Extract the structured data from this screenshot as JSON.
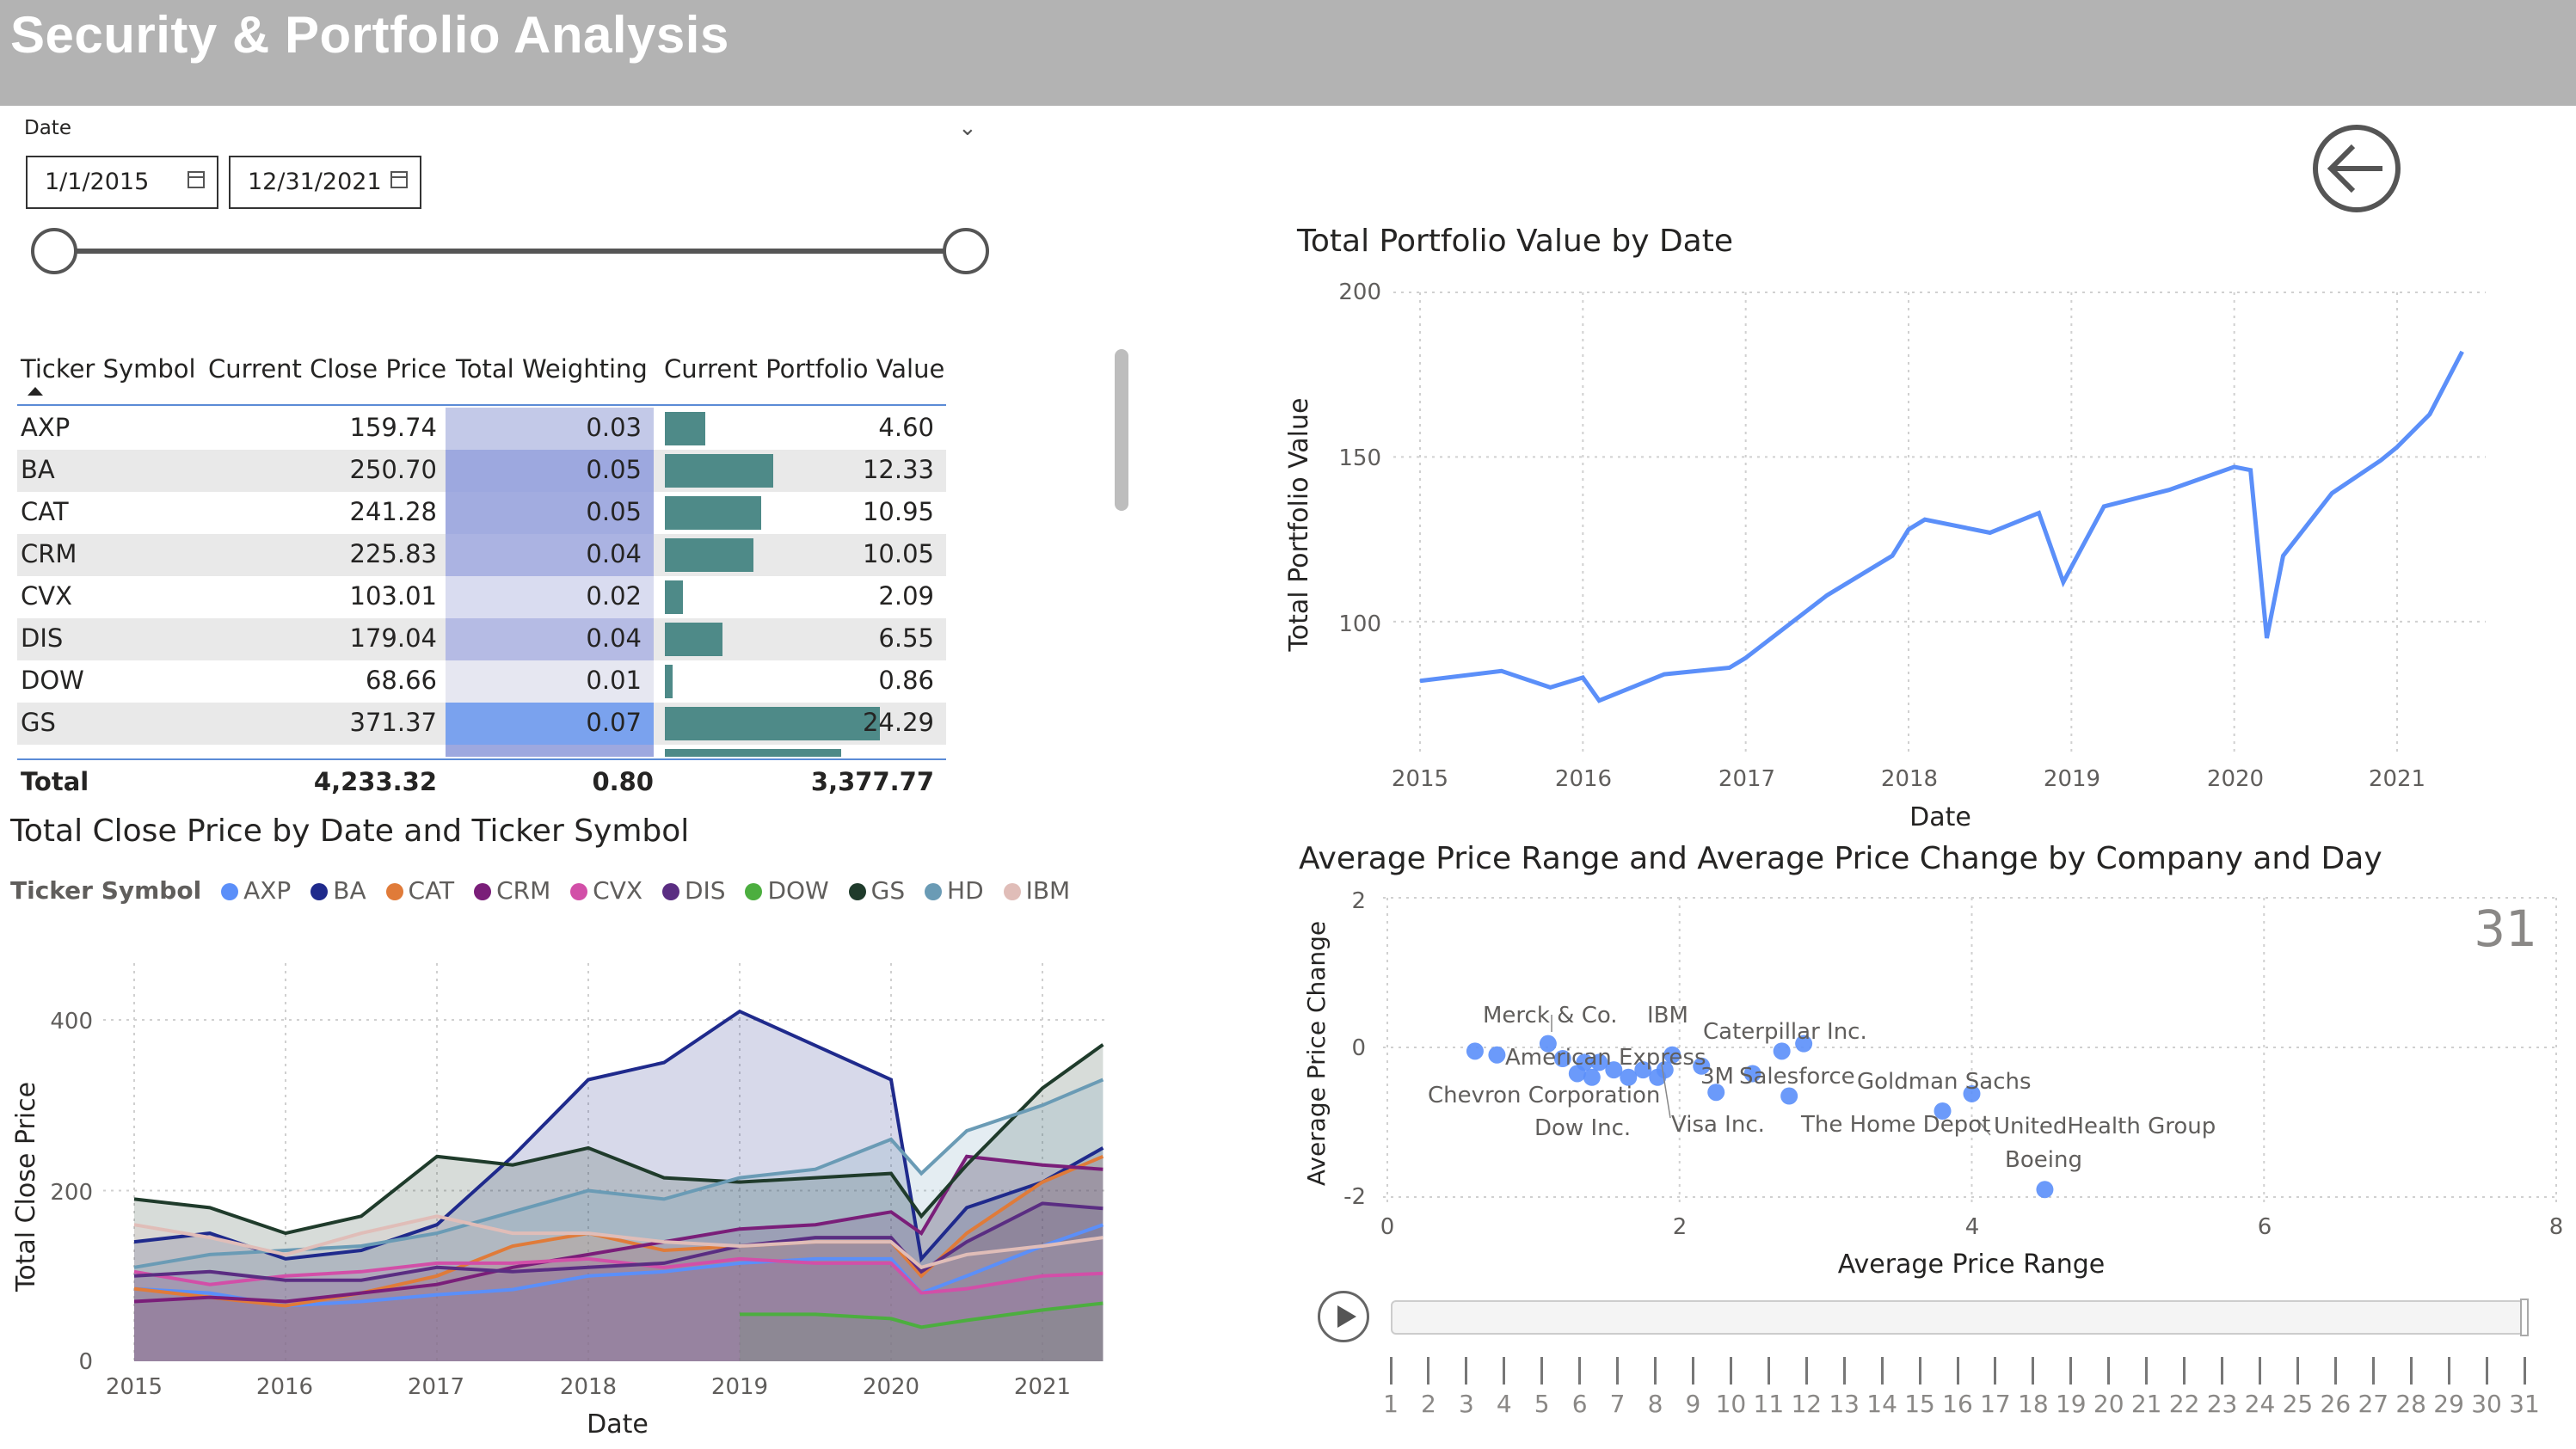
{
  "header": {
    "title": "Security & Portfolio Analysis"
  },
  "date_slicer": {
    "label": "Date",
    "start": "1/1/2015",
    "end": "12/31/2021"
  },
  "table": {
    "columns": [
      "Ticker Symbol",
      "Current Close Price",
      "Total Weighting",
      "Current Portfolio Value"
    ],
    "rows": [
      {
        "ticker": "AXP",
        "price": "159.74",
        "weight": "0.03",
        "value": "4.60"
      },
      {
        "ticker": "BA",
        "price": "250.70",
        "weight": "0.05",
        "value": "12.33"
      },
      {
        "ticker": "CAT",
        "price": "241.28",
        "weight": "0.05",
        "value": "10.95"
      },
      {
        "ticker": "CRM",
        "price": "225.83",
        "weight": "0.04",
        "value": "10.05"
      },
      {
        "ticker": "CVX",
        "price": "103.01",
        "weight": "0.02",
        "value": "2.09"
      },
      {
        "ticker": "DIS",
        "price": "179.04",
        "weight": "0.04",
        "value": "6.55"
      },
      {
        "ticker": "DOW",
        "price": "68.66",
        "weight": "0.01",
        "value": "0.86"
      },
      {
        "ticker": "GS",
        "price": "371.37",
        "weight": "0.07",
        "value": "24.29"
      }
    ],
    "total": {
      "label": "Total",
      "price": "4,233.32",
      "weight": "0.80",
      "value": "3,377.77"
    }
  },
  "close_chart": {
    "title": "Total Close Price by Date and Ticker Symbol",
    "legend_title": "Ticker Symbol",
    "legend": [
      {
        "name": "AXP",
        "color": "#5b8ff9"
      },
      {
        "name": "BA",
        "color": "#1f2a8c"
      },
      {
        "name": "CAT",
        "color": "#e07b39"
      },
      {
        "name": "CRM",
        "color": "#7a1e79"
      },
      {
        "name": "CVX",
        "color": "#d24fa8"
      },
      {
        "name": "DIS",
        "color": "#5a2d82"
      },
      {
        "name": "DOW",
        "color": "#4cae3f"
      },
      {
        "name": "GS",
        "color": "#1f3b2b"
      },
      {
        "name": "HD",
        "color": "#6a9bb5"
      },
      {
        "name": "IBM",
        "color": "#e0bdb8"
      }
    ],
    "yticks": [
      "400",
      "200",
      "0"
    ],
    "xticks": [
      "2015",
      "2016",
      "2017",
      "2018",
      "2019",
      "2020",
      "2021"
    ],
    "xlabel": "Date",
    "ylabel": "Total Close Price"
  },
  "portfolio_chart": {
    "title": "Total Portfolio Value by Date",
    "yticks": [
      "200",
      "150",
      "100"
    ],
    "xticks": [
      "2015",
      "2016",
      "2017",
      "2018",
      "2019",
      "2020",
      "2021"
    ],
    "xlabel": "Date",
    "ylabel": "Total Portfolio Value"
  },
  "scatter_chart": {
    "title": "Average Price Range and Average Price Change by Company and Day",
    "day_label": "31",
    "yticks": [
      "2",
      "0",
      "-2"
    ],
    "xticks": [
      "0",
      "2",
      "4",
      "6",
      "8"
    ],
    "xlabel": "Average Price Range",
    "ylabel": "Average Price Change",
    "labels": [
      "Merck & Co.",
      "IBM",
      "Caterpillar Inc.",
      "American Express",
      "3M",
      "Salesforce",
      "Goldman Sachs",
      "Chevron Corporation",
      "Dow Inc.",
      "Visa Inc.",
      "The Home Depot",
      "UnitedHealth Group",
      "Boeing"
    ]
  },
  "play_axis": {
    "days": [
      "1",
      "2",
      "3",
      "4",
      "5",
      "6",
      "7",
      "8",
      "9",
      "10",
      "11",
      "12",
      "13",
      "14",
      "15",
      "16",
      "17",
      "18",
      "19",
      "20",
      "21",
      "22",
      "23",
      "24",
      "25",
      "26",
      "27",
      "28",
      "29",
      "30",
      "31"
    ]
  },
  "chart_data": [
    {
      "type": "line",
      "title": "Total Portfolio Value by Date",
      "xlabel": "Date",
      "ylabel": "Total Portfolio Value",
      "ylim": [
        60,
        200
      ],
      "x": [
        2015.0,
        2015.5,
        2015.8,
        2016.0,
        2016.1,
        2016.5,
        2016.9,
        2017.0,
        2017.5,
        2017.9,
        2018.0,
        2018.1,
        2018.5,
        2018.8,
        2018.95,
        2019.2,
        2019.6,
        2020.0,
        2020.1,
        2020.2,
        2020.3,
        2020.6,
        2020.9,
        2021.0,
        2021.2,
        2021.4
      ],
      "series": [
        {
          "name": "Total Portfolio Value",
          "values": [
            82,
            85,
            80,
            83,
            76,
            84,
            86,
            89,
            108,
            120,
            128,
            131,
            127,
            133,
            112,
            135,
            140,
            147,
            146,
            95,
            120,
            139,
            149,
            153,
            163,
            182
          ]
        }
      ]
    },
    {
      "type": "area",
      "title": "Total Close Price by Date and Ticker Symbol",
      "xlabel": "Date",
      "ylabel": "Total Close Price",
      "ylim": [
        0,
        460
      ],
      "x": [
        2015.0,
        2015.5,
        2016.0,
        2016.5,
        2017.0,
        2017.5,
        2018.0,
        2018.5,
        2019.0,
        2019.5,
        2020.0,
        2020.2,
        2020.5,
        2021.0,
        2021.4
      ],
      "series": [
        {
          "name": "AXP",
          "values": [
            85,
            80,
            65,
            70,
            78,
            84,
            100,
            105,
            115,
            120,
            120,
            80,
            100,
            135,
            160
          ]
        },
        {
          "name": "BA",
          "values": [
            140,
            150,
            120,
            130,
            160,
            240,
            330,
            350,
            410,
            370,
            330,
            120,
            180,
            210,
            250
          ]
        },
        {
          "name": "CAT",
          "values": [
            85,
            75,
            65,
            80,
            100,
            135,
            150,
            130,
            135,
            140,
            140,
            100,
            150,
            210,
            240
          ]
        },
        {
          "name": "CRM",
          "values": [
            70,
            75,
            70,
            80,
            90,
            110,
            125,
            140,
            155,
            160,
            175,
            150,
            240,
            230,
            225
          ]
        },
        {
          "name": "CVX",
          "values": [
            105,
            90,
            100,
            105,
            115,
            115,
            120,
            110,
            120,
            115,
            115,
            80,
            85,
            100,
            103
          ]
        },
        {
          "name": "DIS",
          "values": [
            100,
            105,
            95,
            95,
            110,
            105,
            110,
            115,
            135,
            145,
            145,
            105,
            140,
            185,
            179
          ]
        },
        {
          "name": "DOW",
          "values": [
            null,
            null,
            null,
            null,
            null,
            null,
            null,
            null,
            55,
            55,
            50,
            40,
            48,
            60,
            68
          ]
        },
        {
          "name": "GS",
          "values": [
            190,
            180,
            150,
            170,
            240,
            230,
            250,
            215,
            210,
            215,
            220,
            170,
            230,
            320,
            371
          ]
        },
        {
          "name": "HD",
          "values": [
            110,
            125,
            130,
            135,
            150,
            175,
            200,
            190,
            215,
            225,
            260,
            220,
            270,
            300,
            330
          ]
        },
        {
          "name": "IBM",
          "values": [
            160,
            145,
            125,
            150,
            170,
            150,
            150,
            140,
            135,
            140,
            140,
            110,
            125,
            135,
            145
          ]
        }
      ]
    },
    {
      "type": "scatter",
      "title": "Average Price Range and Average Price Change by Company and Day",
      "xlabel": "Average Price Range",
      "ylabel": "Average Price Change",
      "xlim": [
        0,
        8
      ],
      "ylim": [
        -2,
        2
      ],
      "points": [
        {
          "x": 0.6,
          "y": -0.05
        },
        {
          "x": 0.75,
          "y": -0.1
        },
        {
          "x": 1.1,
          "y": 0.05
        },
        {
          "x": 1.2,
          "y": -0.15
        },
        {
          "x": 1.3,
          "y": -0.35
        },
        {
          "x": 1.35,
          "y": -0.2
        },
        {
          "x": 1.4,
          "y": -0.4
        },
        {
          "x": 1.45,
          "y": -0.2
        },
        {
          "x": 1.55,
          "y": -0.3
        },
        {
          "x": 1.65,
          "y": -0.4
        },
        {
          "x": 1.75,
          "y": -0.3
        },
        {
          "x": 1.85,
          "y": -0.4
        },
        {
          "x": 1.9,
          "y": -0.3
        },
        {
          "x": 1.95,
          "y": -0.1
        },
        {
          "x": 2.15,
          "y": -0.25
        },
        {
          "x": 2.25,
          "y": -0.6
        },
        {
          "x": 2.5,
          "y": -0.35
        },
        {
          "x": 2.7,
          "y": -0.05
        },
        {
          "x": 2.75,
          "y": -0.65
        },
        {
          "x": 2.85,
          "y": 0.05
        },
        {
          "x": 3.8,
          "y": -0.85
        },
        {
          "x": 4.0,
          "y": -0.62
        },
        {
          "x": 4.5,
          "y": -1.9
        }
      ]
    }
  ]
}
